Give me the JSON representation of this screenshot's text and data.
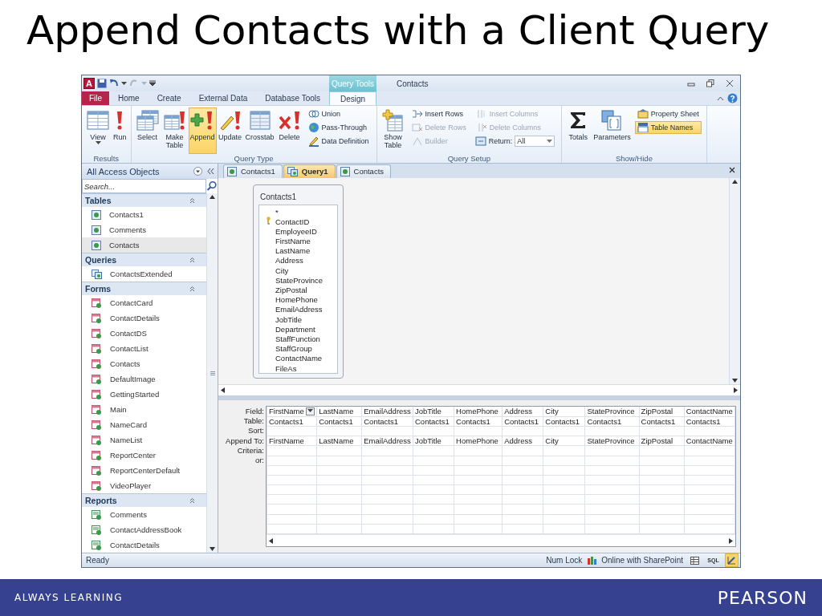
{
  "slide": {
    "title": "Append Contacts with a Client Query",
    "footer_text": "ALWAYS LEARNING",
    "footer_logo": "PEARSON"
  },
  "window": {
    "app_logo": "A",
    "context_tab": "Query Tools",
    "title": "Contacts"
  },
  "ribbon_tabs": [
    {
      "label": "File",
      "kind": "file",
      "selected": false
    },
    {
      "label": "Home",
      "kind": "tab",
      "selected": false
    },
    {
      "label": "Create",
      "kind": "tab",
      "selected": false
    },
    {
      "label": "External Data",
      "kind": "tab",
      "selected": false
    },
    {
      "label": "Database Tools",
      "kind": "tab",
      "selected": false
    },
    {
      "label": "Design",
      "kind": "context",
      "selected": true
    }
  ],
  "ribbon_groups": [
    {
      "label": "Results",
      "columns": [
        {
          "kind": "large",
          "label": "View",
          "selected": false,
          "dropdown": true
        },
        {
          "kind": "large",
          "label": "Run",
          "selected": false
        }
      ]
    },
    {
      "label": "Query Type",
      "columns": [
        {
          "kind": "large",
          "label": "Select",
          "selected": false
        },
        {
          "kind": "large",
          "label": "Make Table",
          "selected": false
        },
        {
          "kind": "large",
          "label": "Append",
          "selected": true
        },
        {
          "kind": "large",
          "label": "Update",
          "selected": false
        },
        {
          "kind": "large",
          "label": "Crosstab",
          "selected": false
        },
        {
          "kind": "large",
          "label": "Delete",
          "selected": false
        },
        {
          "kind": "stack",
          "items": [
            {
              "kind": "button",
              "label": "Union",
              "disabled": false,
              "selected": false
            },
            {
              "kind": "button",
              "label": "Pass-Through",
              "disabled": false,
              "selected": false
            },
            {
              "kind": "button",
              "label": "Data Definition",
              "disabled": false,
              "selected": false
            }
          ]
        }
      ]
    },
    {
      "label": "Query Setup",
      "columns": [
        {
          "kind": "large",
          "label": "Show Table",
          "selected": false
        },
        {
          "kind": "stack",
          "items": [
            {
              "kind": "button",
              "label": "Insert Rows",
              "disabled": false,
              "selected": false
            },
            {
              "kind": "button",
              "label": "Delete Rows",
              "disabled": true,
              "selected": false
            },
            {
              "kind": "button",
              "label": "Builder",
              "disabled": true,
              "selected": false
            }
          ]
        },
        {
          "kind": "stack",
          "items": [
            {
              "kind": "button",
              "label": "Insert Columns",
              "disabled": true,
              "selected": false
            },
            {
              "kind": "button",
              "label": "Delete Columns",
              "disabled": true,
              "selected": false
            },
            {
              "kind": "combo",
              "label": "Return:",
              "value": "All",
              "disabled": false
            }
          ]
        }
      ]
    },
    {
      "label": "Show/Hide",
      "columns": [
        {
          "kind": "large",
          "label": "Totals",
          "selected": false
        },
        {
          "kind": "large",
          "label": "Parameters",
          "selected": false
        },
        {
          "kind": "stack",
          "items": [
            {
              "kind": "button",
              "label": "Property Sheet",
              "disabled": false,
              "selected": false
            },
            {
              "kind": "button",
              "label": "Table Names",
              "disabled": false,
              "selected": true
            }
          ]
        }
      ]
    }
  ],
  "nav_pane": {
    "header": "All Access Objects",
    "search_placeholder": "Search...",
    "groups": [
      {
        "label": "Tables",
        "kind": "table",
        "items": [
          {
            "label": "Contacts1",
            "selected": false
          },
          {
            "label": "Comments",
            "selected": false
          },
          {
            "label": "Contacts",
            "selected": true
          }
        ]
      },
      {
        "label": "Queries",
        "kind": "query",
        "items": [
          {
            "label": "ContactsExtended",
            "selected": false
          }
        ]
      },
      {
        "label": "Forms",
        "kind": "form",
        "items": [
          {
            "label": "ContactCard",
            "selected": false
          },
          {
            "label": "ContactDetails",
            "selected": false
          },
          {
            "label": "ContactDS",
            "selected": false
          },
          {
            "label": "ContactList",
            "selected": false
          },
          {
            "label": "Contacts",
            "selected": false
          },
          {
            "label": "DefaultImage",
            "selected": false
          },
          {
            "label": "GettingStarted",
            "selected": false
          },
          {
            "label": "Main",
            "selected": false
          },
          {
            "label": "NameCard",
            "selected": false
          },
          {
            "label": "NameList",
            "selected": false
          },
          {
            "label": "ReportCenter",
            "selected": false
          },
          {
            "label": "ReportCenterDefault",
            "selected": false
          },
          {
            "label": "VideoPlayer",
            "selected": false
          }
        ]
      },
      {
        "label": "Reports",
        "kind": "report",
        "items": [
          {
            "label": "Comments",
            "selected": false
          },
          {
            "label": "ContactAddressBook",
            "selected": false
          },
          {
            "label": "ContactDetails",
            "selected": false
          }
        ]
      }
    ]
  },
  "doc_tabs": [
    {
      "label": "Contacts1",
      "kind": "table",
      "selected": false
    },
    {
      "label": "Query1",
      "kind": "query",
      "selected": true
    },
    {
      "label": "Contacts",
      "kind": "table",
      "selected": false
    }
  ],
  "field_list": {
    "title": "Contacts1",
    "fields": [
      {
        "name": "*",
        "key": false
      },
      {
        "name": "ContactID",
        "key": true
      },
      {
        "name": "EmployeeID",
        "key": false
      },
      {
        "name": "FirstName",
        "key": false
      },
      {
        "name": "LastName",
        "key": false
      },
      {
        "name": "Address",
        "key": false
      },
      {
        "name": "City",
        "key": false
      },
      {
        "name": "StateProvince",
        "key": false
      },
      {
        "name": "ZipPostal",
        "key": false
      },
      {
        "name": "HomePhone",
        "key": false
      },
      {
        "name": "EmailAddress",
        "key": false
      },
      {
        "name": "JobTitle",
        "key": false
      },
      {
        "name": "Department",
        "key": false
      },
      {
        "name": "StaffFunction",
        "key": false
      },
      {
        "name": "StaffGroup",
        "key": false
      },
      {
        "name": "ContactName",
        "key": false
      },
      {
        "name": "FileAs",
        "key": false
      }
    ]
  },
  "grid": {
    "row_labels": [
      "Field:",
      "Table:",
      "Sort:",
      "Append To:",
      "Criteria:",
      "or:"
    ],
    "columns": [
      {
        "field": "FirstName",
        "table": "Contacts1",
        "append_to": "FirstName",
        "focused": true
      },
      {
        "field": "LastName",
        "table": "Contacts1",
        "append_to": "LastName",
        "focused": false
      },
      {
        "field": "EmailAddress",
        "table": "Contacts1",
        "append_to": "EmailAddress",
        "focused": false
      },
      {
        "field": "JobTitle",
        "table": "Contacts1",
        "append_to": "JobTitle",
        "focused": false
      },
      {
        "field": "HomePhone",
        "table": "Contacts1",
        "append_to": "HomePhone",
        "focused": false
      },
      {
        "field": "Address",
        "table": "Contacts1",
        "append_to": "Address",
        "focused": false
      },
      {
        "field": "City",
        "table": "Contacts1",
        "append_to": "City",
        "focused": false
      },
      {
        "field": "StateProvince",
        "table": "Contacts1",
        "append_to": "StateProvince",
        "focused": false
      },
      {
        "field": "ZipPostal",
        "table": "Contacts1",
        "append_to": "ZipPostal",
        "focused": false
      },
      {
        "field": "ContactName",
        "table": "Contacts1",
        "append_to": "ContactName",
        "focused": false
      }
    ]
  },
  "status_bar": {
    "text": "Ready",
    "indicator": "Num Lock",
    "sharepoint": "Online with SharePoint",
    "view_buttons": [
      {
        "kind": "datasheet",
        "selected": false
      },
      {
        "kind": "sql",
        "label": "SQL",
        "selected": false
      },
      {
        "kind": "design",
        "selected": true
      }
    ]
  }
}
